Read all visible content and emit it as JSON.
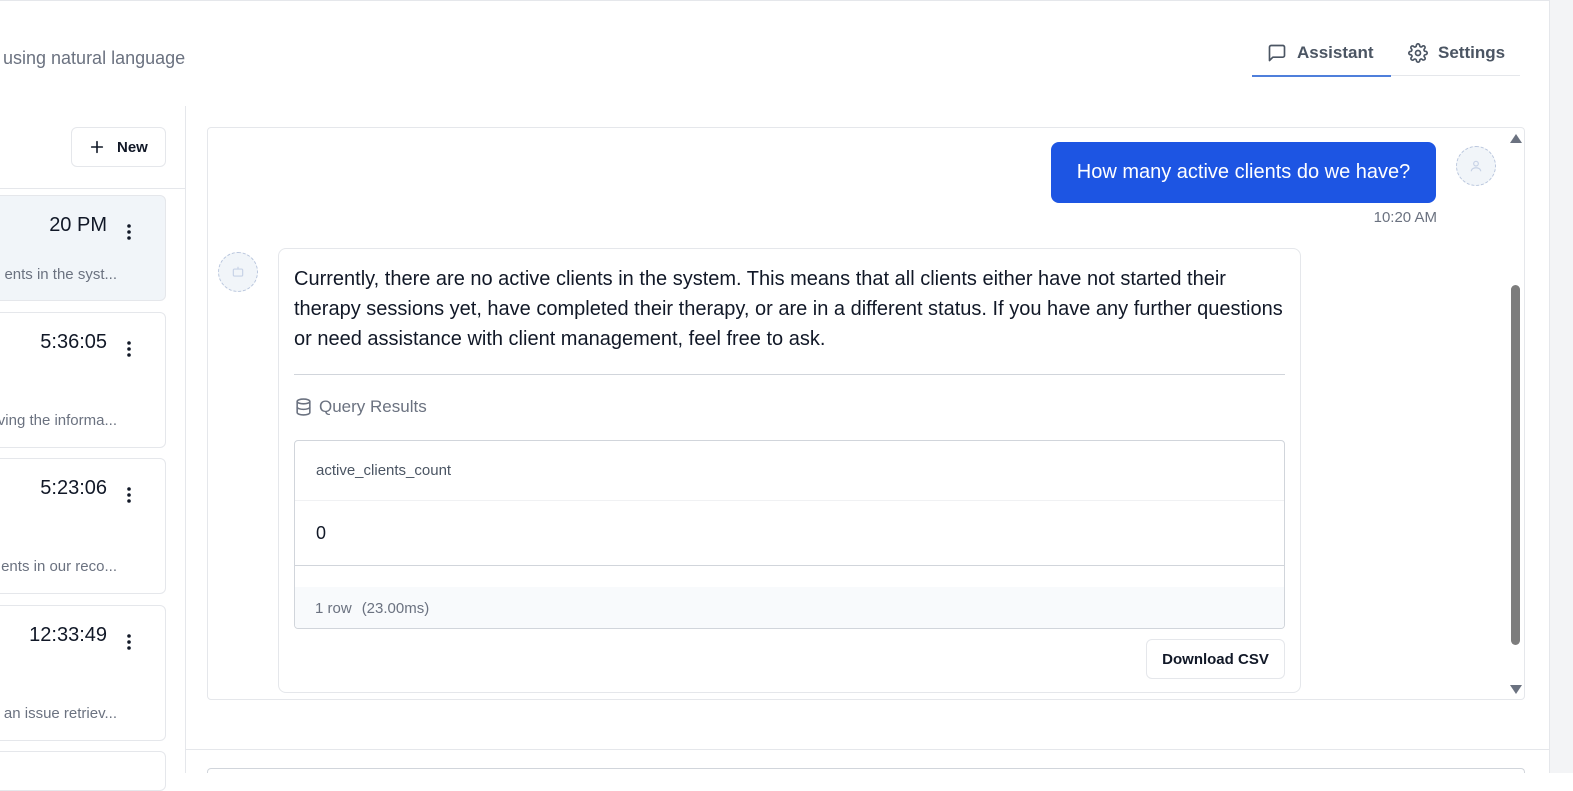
{
  "header": {
    "subtitle": "using natural language"
  },
  "tabs": [
    {
      "label": "Assistant",
      "icon": "message-square-icon",
      "active": true
    },
    {
      "label": "Settings",
      "icon": "gear-icon",
      "active": false
    }
  ],
  "sidebar": {
    "new_label": "New",
    "conversations": [
      {
        "title": "20 PM",
        "preview": "ents in the syst...",
        "active": true
      },
      {
        "title": "5:36:05",
        "preview": "eving the informa...",
        "active": false
      },
      {
        "title": "5:23:06",
        "preview": "ents in our reco...",
        "active": false
      },
      {
        "title": "12:33:49",
        "preview": "an issue retriev...",
        "active": false
      }
    ]
  },
  "chat": {
    "user_message": "How many active clients do we have?",
    "user_time": "10:20 AM",
    "assistant_message": "Currently, there are no active clients in the system. This means that all clients either have not started their therapy sessions yet, have completed their therapy, or are in a different status. If you have any further questions or need assistance with client management, feel free to ask.",
    "query_results": {
      "title": "Query Results",
      "column": "active_clients_count",
      "value": "0",
      "row_count": "1 row",
      "duration": "(23.00ms)"
    },
    "download_label": "Download CSV"
  },
  "colors": {
    "accent": "#1d55e3",
    "tab_underline": "#4f7fdb"
  }
}
